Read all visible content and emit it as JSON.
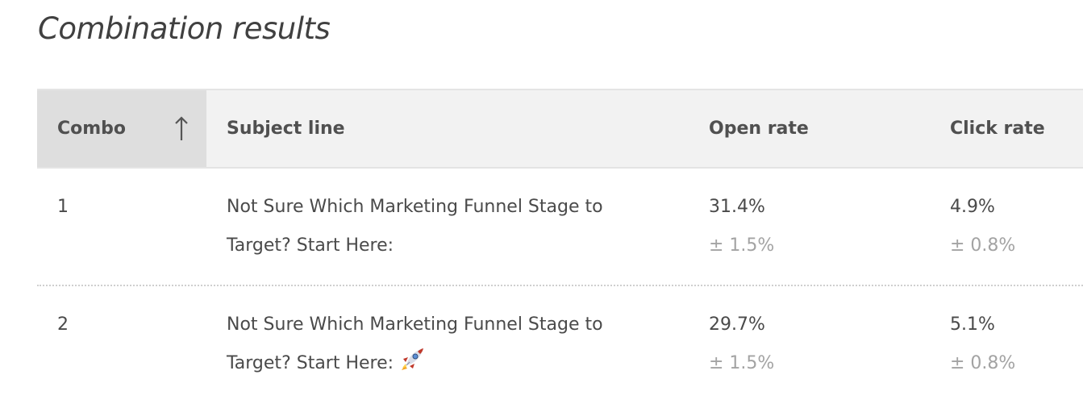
{
  "page": {
    "title": "Combination results"
  },
  "table": {
    "columns": {
      "combo": "Combo",
      "subject": "Subject line",
      "open_rate": "Open rate",
      "click_rate": "Click rate"
    },
    "sort": {
      "column": "combo",
      "direction": "ascending",
      "icon": "arrow-up-icon"
    },
    "rows": [
      {
        "combo": "1",
        "subject_line1": "Not Sure Which Marketing Funnel Stage to",
        "subject_line2": "Target? Start Here:",
        "subject_emoji": "",
        "open_rate": "31.4%",
        "open_margin": "± 1.5%",
        "click_rate": "4.9%",
        "click_margin": "± 0.8%"
      },
      {
        "combo": "2",
        "subject_line1": "Not Sure Which Marketing Funnel Stage to",
        "subject_line2": "Target? Start Here:",
        "subject_emoji": "rocket-icon",
        "open_rate": "29.7%",
        "open_margin": "± 1.5%",
        "click_rate": "5.1%",
        "click_margin": "± 0.8%"
      }
    ]
  }
}
